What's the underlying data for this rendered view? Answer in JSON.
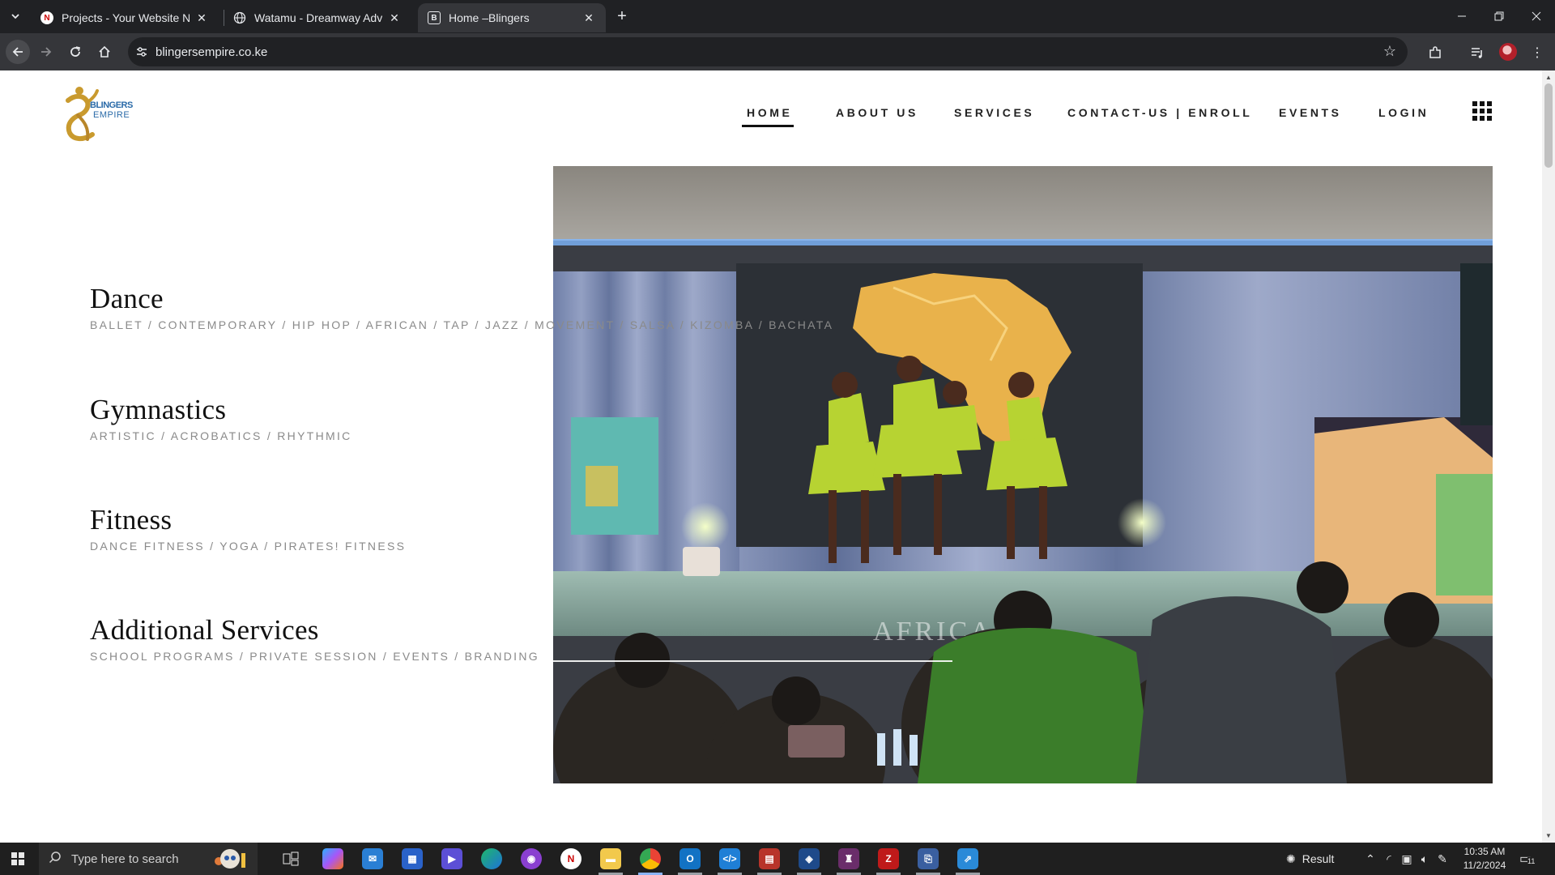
{
  "browser": {
    "tabs": [
      {
        "title": "Projects - Your Website Name",
        "favicon": "n-circle-icon",
        "active": false
      },
      {
        "title": "Watamu - Dreamway Adventur",
        "favicon": "globe-icon",
        "active": false
      },
      {
        "title": "Home –Blingers",
        "favicon": "b-logo-icon",
        "active": true
      }
    ],
    "url": "blingersempire.co.ke"
  },
  "site": {
    "logo_text": [
      "BLINGERS",
      "EMPIRE"
    ],
    "nav": [
      {
        "label": "HOME",
        "active": true
      },
      {
        "label": "ABOUT US",
        "active": false
      },
      {
        "label": "SERVICES",
        "active": false
      },
      {
        "label": "CONTACT-US | ENROLL",
        "active": false
      },
      {
        "label": "EVENTS",
        "active": false
      },
      {
        "label": "LOGIN",
        "active": false
      }
    ],
    "services": [
      {
        "title": "Dance",
        "subtitle": "BALLET / CONTEMPORARY / HIP HOP / AFRICAN / TAP / JAZZ / MOVEMENT / SALSA / KIZOMBA / BACHATA"
      },
      {
        "title": "Gymnastics",
        "subtitle": "ARTISTIC / ACROBATICS / RHYTHMIC"
      },
      {
        "title": "Fitness",
        "subtitle": "DANCE FITNESS / YOGA / PIRATES! FITNESS"
      },
      {
        "title": "Additional Services",
        "subtitle": "SCHOOL PROGRAMS / PRIVATE SESSION / EVENTS / BRANDING"
      }
    ],
    "hero_banner_text": "AFRICA",
    "colors": {
      "logo_gold": "#c99a2e",
      "logo_blue": "#2a6aa8",
      "text_dark": "#111111",
      "subtitle_grey": "#8a8a8a"
    }
  },
  "taskbar": {
    "search_placeholder": "Type here to search",
    "weather_label": "Result",
    "time": "10:35 AM",
    "date": "11/2/2024",
    "notification_count": "11"
  }
}
